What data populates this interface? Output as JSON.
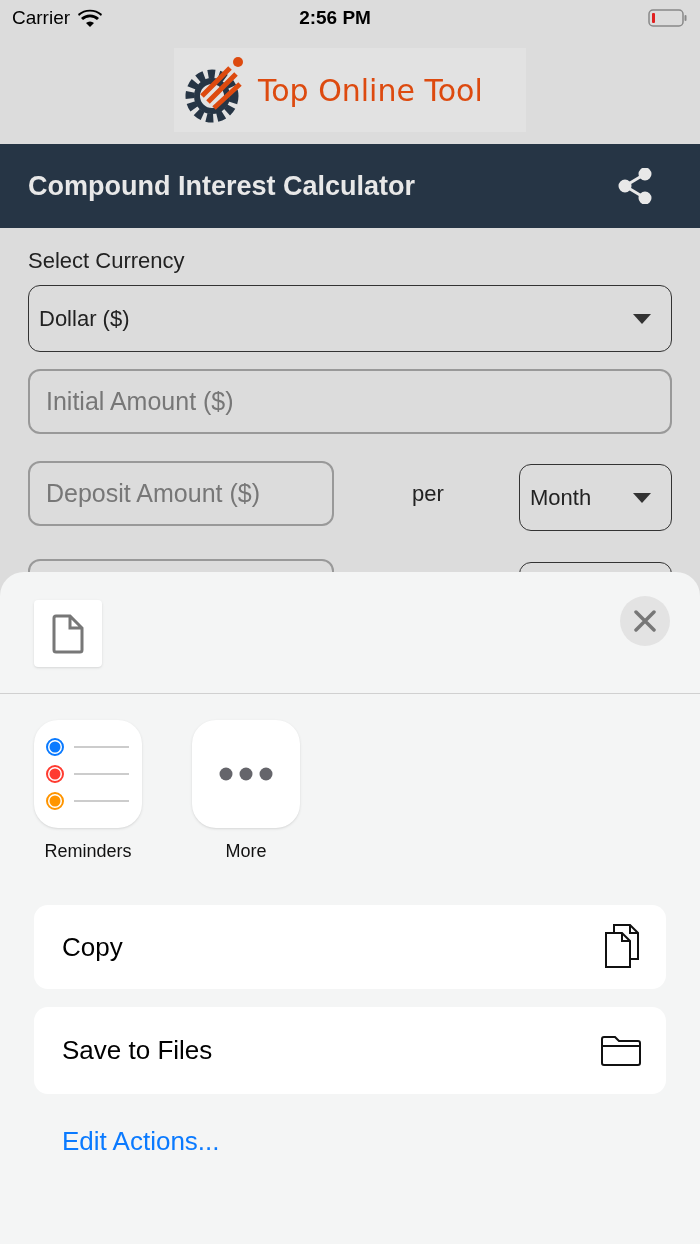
{
  "status_bar": {
    "carrier": "Carrier",
    "time": "2:56 PM"
  },
  "logo": {
    "text": "Top Online Tool"
  },
  "header": {
    "title": "Compound Interest Calculator"
  },
  "form": {
    "currency_label": "Select Currency",
    "currency_select": {
      "value": "Dollar ($)"
    },
    "initial_amount": {
      "placeholder": "Initial Amount ($)"
    },
    "deposit_amount": {
      "placeholder": "Deposit Amount ($)"
    },
    "per_label": "per",
    "period_select": {
      "value": "Month"
    }
  },
  "share_sheet": {
    "apps": [
      {
        "label": "Reminders",
        "kind": "reminders"
      },
      {
        "label": "More",
        "kind": "more"
      }
    ],
    "actions": [
      {
        "label": "Copy",
        "kind": "copy"
      },
      {
        "label": "Save to Files",
        "kind": "files"
      }
    ],
    "edit_actions": "Edit Actions..."
  }
}
